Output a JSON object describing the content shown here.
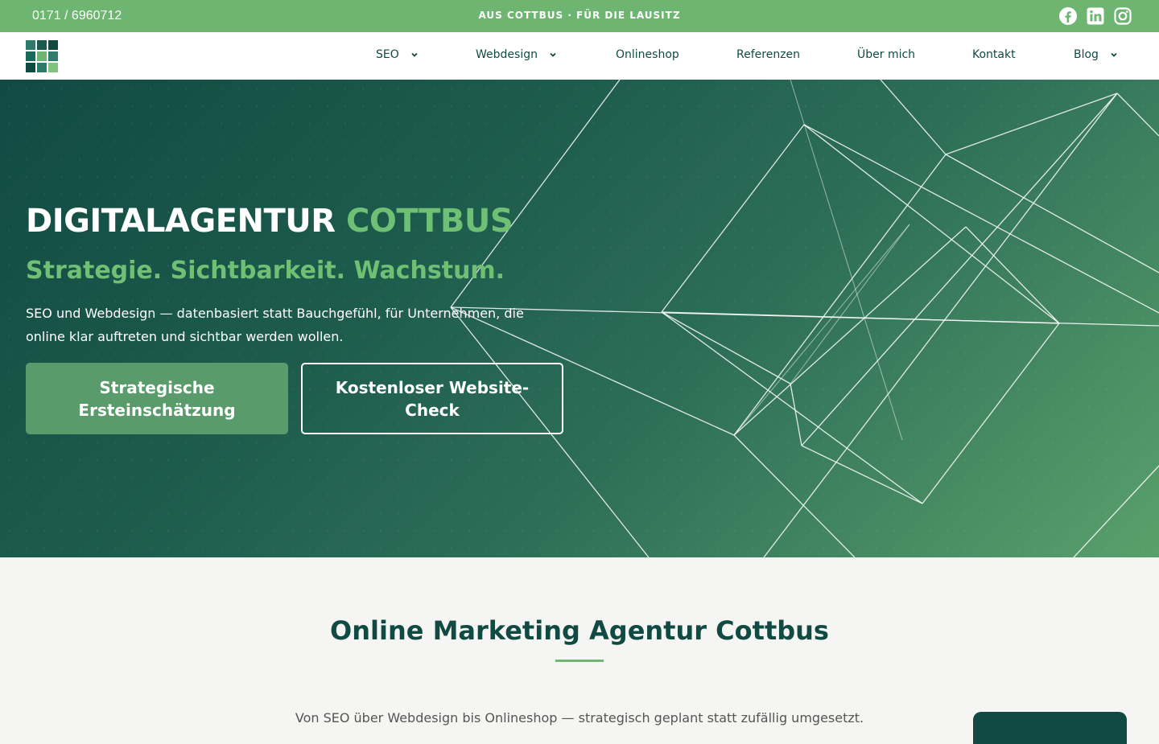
{
  "topbar": {
    "phone": "0171 / 6960712",
    "tagline": "AUS COTTBUS · FÜR DIE LAUSITZ",
    "social_icons": [
      "facebook-icon",
      "linkedin-icon",
      "instagram-icon"
    ]
  },
  "nav": {
    "items": [
      {
        "label": "SEO",
        "dropdown": true
      },
      {
        "label": "Webdesign",
        "dropdown": true
      },
      {
        "label": "Onlineshop",
        "dropdown": false
      },
      {
        "label": "Referenzen",
        "dropdown": false
      },
      {
        "label": "Über mich",
        "dropdown": false
      },
      {
        "label": "Kontakt",
        "dropdown": false
      },
      {
        "label": "Blog",
        "dropdown": true
      }
    ]
  },
  "hero": {
    "title_main": "DIGITALAGENTUR",
    "title_accent": "COTTBUS",
    "subtitle": "Strategie. Sichtbarkeit. Wachstum.",
    "lead": "SEO und Webdesign — datenbasiert statt Bauchgefühl, für Unternehmen, die online klar auftreten und sichtbar werden wollen.",
    "cta_primary": "Strategische Ersteinschätzung",
    "cta_secondary": "Kostenloser Website-Check"
  },
  "section": {
    "title": "Online Marketing Agentur Cottbus",
    "text": "Von SEO über Webdesign bis Onlineshop — strategisch geplant statt zufällig umgesetzt."
  },
  "colors": {
    "brand_dark": "#114a43",
    "brand_green": "#6db571",
    "accent_green": "#6fbf75",
    "button_green": "#5a9b6b"
  }
}
